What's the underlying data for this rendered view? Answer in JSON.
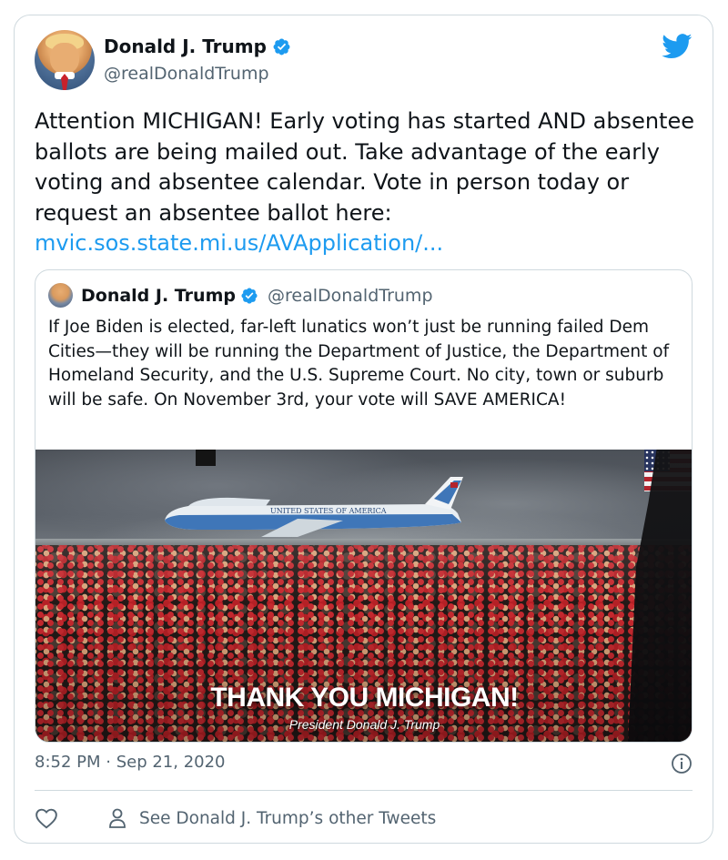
{
  "author": {
    "name": "Donald J. Trump",
    "handle": "@realDonaldTrump",
    "verified": true
  },
  "tweet": {
    "text": "Attention MICHIGAN! Early voting has started AND absentee ballots are being mailed out. Take advantage of the early voting and absentee calendar. Vote in person today or request an absentee ballot here: ",
    "link_text": "mvic.sos.state.mi.us/AVApplication/...",
    "timestamp": "8:52 PM · Sep 21, 2020"
  },
  "quoted_tweet": {
    "name": "Donald J. Trump",
    "handle": "@realDonaldTrump",
    "verified": true,
    "text": "If Joe Biden is elected, far-left lunatics won’t just be running failed Dem Cities—they will be running the Department of Justice, the Department of Homeland Security, and the U.S. Supreme Court. No city, town or suburb will be safe. On November 3rd, your vote will SAVE AMERICA!",
    "media": {
      "headline": "THANK YOU MICHIGAN!",
      "subline": "President Donald J. Trump",
      "plane_text": "UNITED STATES OF AMERICA"
    }
  },
  "actions": {
    "like_icon": "heart-icon",
    "profile_icon": "person-icon",
    "other_tweets_label": "See Donald J. Trump’s other Tweets"
  },
  "icons": {
    "brand": "twitter-bird-icon",
    "verified": "verified-badge-icon",
    "info": "info-icon"
  },
  "colors": {
    "link": "#1d9bf0",
    "secondary_text": "#536471",
    "border": "#cfd9de",
    "brand": "#1d9bf0"
  }
}
